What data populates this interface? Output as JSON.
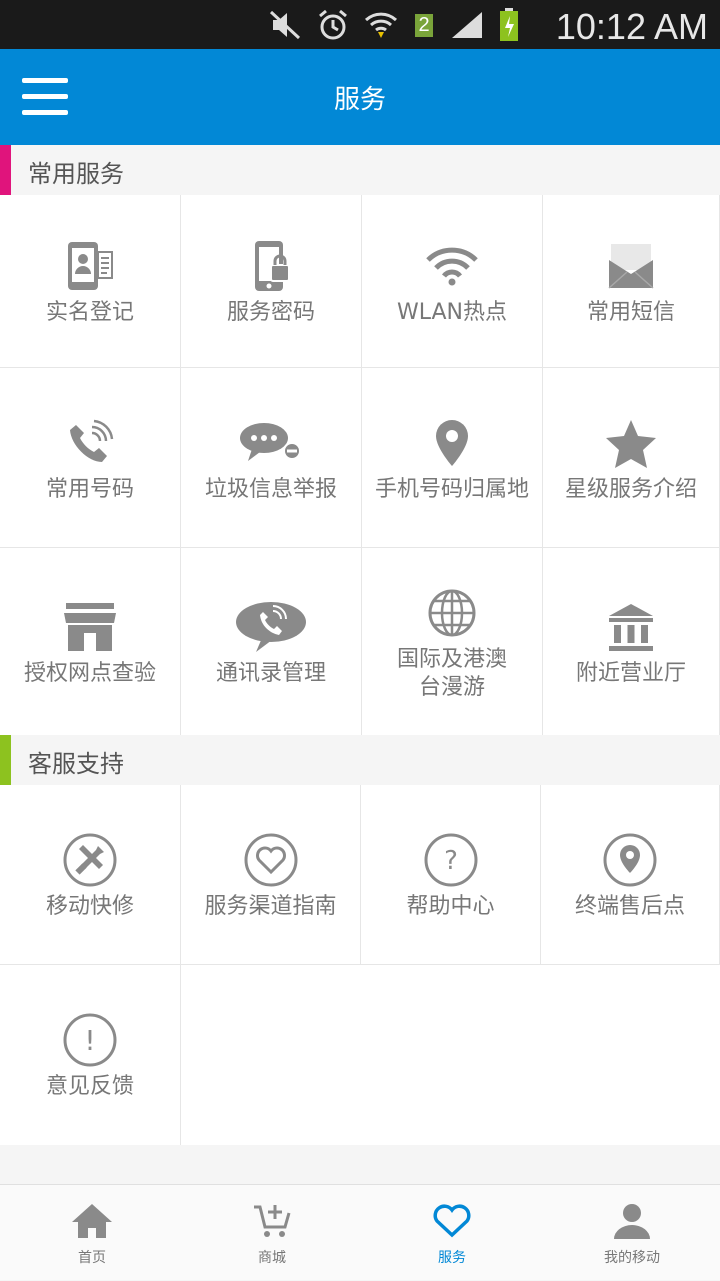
{
  "status": {
    "time": "10:12 AM",
    "sim_badge": "2"
  },
  "appbar": {
    "title": "服务"
  },
  "sections": {
    "common": {
      "title": "常用服务",
      "accent": "#e0147c"
    },
    "support": {
      "title": "客服支持",
      "accent": "#8dc21f"
    }
  },
  "common": [
    {
      "label": "实名登记",
      "icon": "id-card-icon"
    },
    {
      "label": "服务密码",
      "icon": "phone-lock-icon"
    },
    {
      "label": "WLAN热点",
      "icon": "wifi-icon"
    },
    {
      "label": "常用短信",
      "icon": "envelope-icon"
    },
    {
      "label": "常用号码",
      "icon": "phone-call-icon"
    },
    {
      "label": "垃圾信息举报",
      "icon": "chat-block-icon"
    },
    {
      "label": "手机号码归属地",
      "icon": "location-pin-icon"
    },
    {
      "label": "星级服务介绍",
      "icon": "star-icon"
    },
    {
      "label": "授权网点查验",
      "icon": "shop-icon"
    },
    {
      "label": "通讯录管理",
      "icon": "phone-bubble-icon"
    },
    {
      "label1": "国际及港澳",
      "label2": "台漫游",
      "icon": "globe-icon"
    },
    {
      "label": "附近营业厅",
      "icon": "bank-icon"
    }
  ],
  "support": [
    {
      "label": "移动快修",
      "icon": "tools-icon"
    },
    {
      "label": "服务渠道指南",
      "icon": "heart-circle-icon"
    },
    {
      "label": "帮助中心",
      "icon": "question-circle-icon"
    },
    {
      "label": "终端售后点",
      "icon": "pin-circle-icon"
    },
    {
      "label": "意见反馈",
      "icon": "exclamation-circle-icon"
    }
  ],
  "nav": [
    {
      "label": "首页",
      "icon": "home-icon"
    },
    {
      "label": "商城",
      "icon": "cart-icon"
    },
    {
      "label": "服务",
      "icon": "heart-icon"
    },
    {
      "label": "我的移动",
      "icon": "user-icon"
    }
  ],
  "colors": {
    "primary": "#0288d6",
    "icon_gray": "#8a8a8a"
  }
}
